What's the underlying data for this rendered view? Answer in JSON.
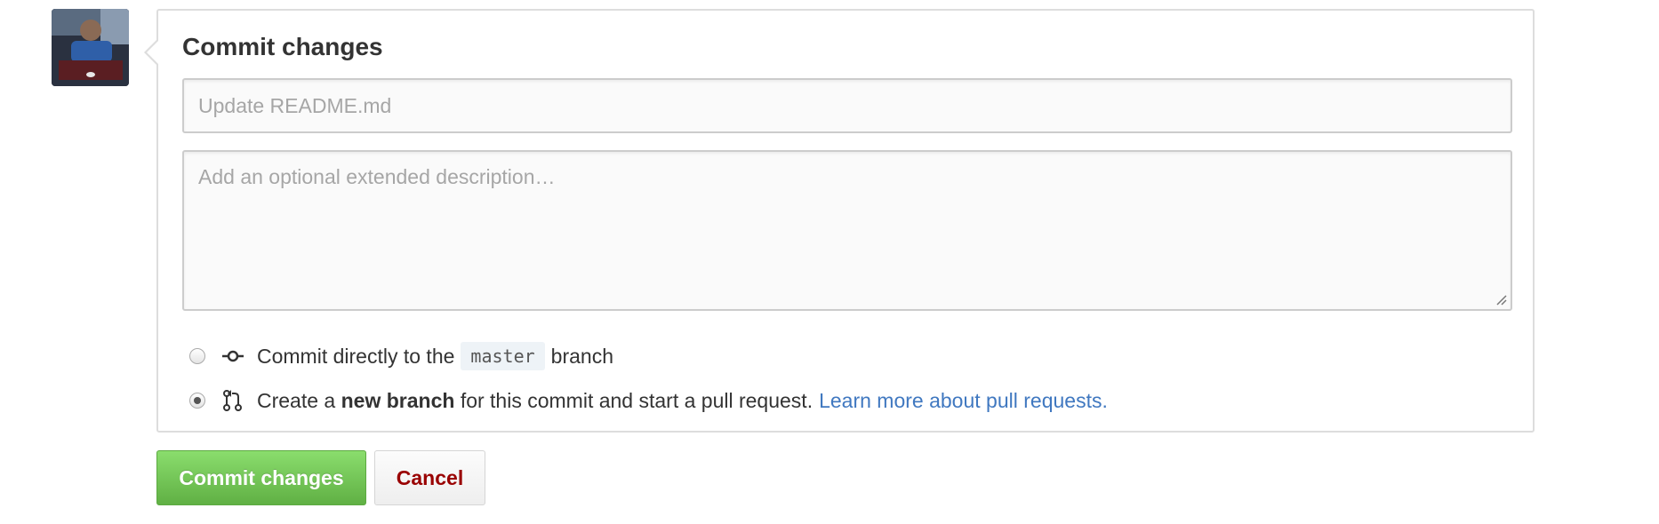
{
  "commit_form": {
    "title": "Commit changes",
    "summary_placeholder": "Update README.md",
    "description_placeholder": "Add an optional extended description…",
    "options": {
      "direct": {
        "text_before": "Commit directly to the",
        "branch": "master",
        "text_after": "branch",
        "selected": false,
        "icon": "git-commit-icon"
      },
      "new_branch": {
        "text_before": "Create a",
        "bold": "new branch",
        "text_after": "for this commit and start a pull request.",
        "link": "Learn more about pull requests.",
        "selected": true,
        "icon": "git-pull-request-icon"
      }
    }
  },
  "actions": {
    "commit_label": "Commit changes",
    "cancel_label": "Cancel"
  },
  "colors": {
    "commit_button": "#6cc644",
    "cancel_text": "#990000",
    "link": "#4078c0"
  }
}
